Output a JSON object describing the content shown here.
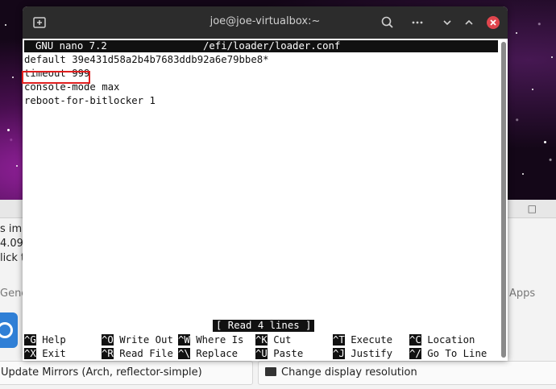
{
  "terminal": {
    "title": "joe@joe-virtualbox:~",
    "nano": {
      "version": "GNU nano 7.2",
      "file_path": "/efi/loader/loader.conf",
      "lines": [
        "default 39e431d58a2b4b7683ddb92a6e79bbe8*",
        "timeout 999",
        "console-mode max",
        "reboot-for-bitlocker 1"
      ],
      "highlighted_line_index": 1,
      "status_message": "[ Read 4 lines ]",
      "shortcuts": [
        {
          "key": "^G",
          "label": "Help"
        },
        {
          "key": "^X",
          "label": "Exit"
        },
        {
          "key": "^O",
          "label": "Write Out"
        },
        {
          "key": "^R",
          "label": "Read File"
        },
        {
          "key": "^W",
          "label": "Where Is"
        },
        {
          "key": "^\\",
          "label": "Replace"
        },
        {
          "key": "^K",
          "label": "Cut"
        },
        {
          "key": "^U",
          "label": "Paste"
        },
        {
          "key": "^T",
          "label": "Execute"
        },
        {
          "key": "^J",
          "label": "Justify"
        },
        {
          "key": "^C",
          "label": "Location"
        },
        {
          "key": "^/",
          "label": "Go To Line"
        }
      ]
    },
    "icons": [
      "new-tab-icon",
      "search-icon",
      "menu-icon",
      "minimize-icon",
      "maximize-icon",
      "close-icon"
    ],
    "close_color": "#e0454d"
  },
  "background_app": {
    "fragments": {
      "impo": "s impo",
      "ver": "4.09",
      "click": "lick t",
      "gene": "Gene",
      "apps": "Apps"
    },
    "buttons": {
      "update_mirrors": "Update Mirrors (Arch, reflector-simple)",
      "change_resolution": "Change display resolution"
    },
    "accent": "#2f7fd6"
  }
}
